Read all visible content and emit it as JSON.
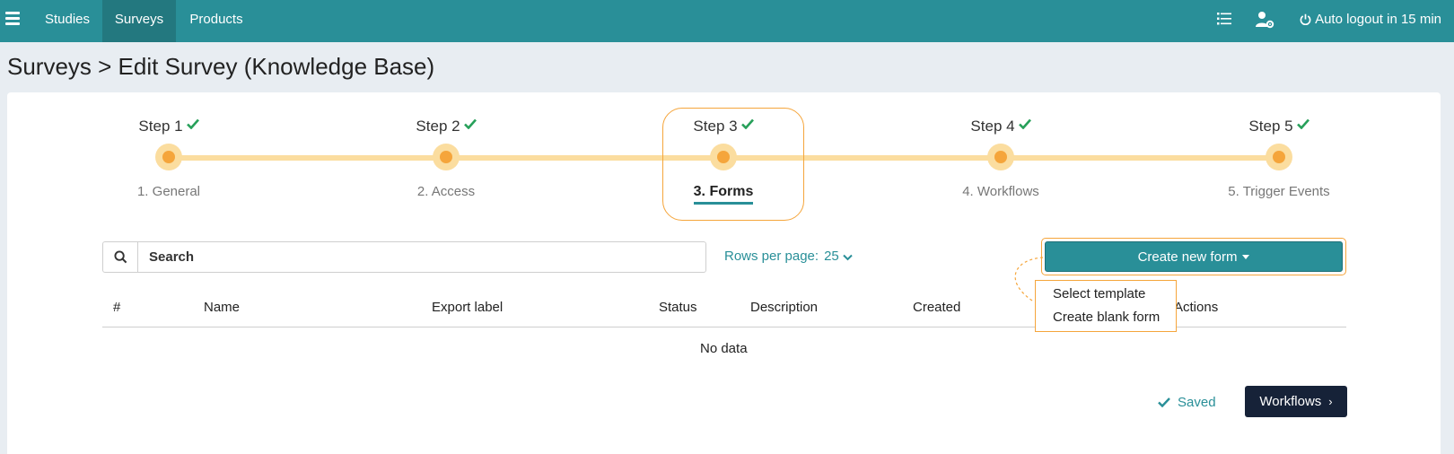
{
  "nav": {
    "items": [
      {
        "label": "Studies",
        "active": false
      },
      {
        "label": "Surveys",
        "active": true
      },
      {
        "label": "Products",
        "active": false
      }
    ],
    "icons": [
      "hamburger-icon",
      "list-icon",
      "user-settings-icon",
      "power-icon"
    ],
    "logout_text": "Auto logout in 15 min"
  },
  "page": {
    "title": "Surveys > Edit Survey (Knowledge Base)"
  },
  "stepper": {
    "steps": [
      {
        "title": "Step 1",
        "label": "1. General",
        "completed": true,
        "active": false
      },
      {
        "title": "Step 2",
        "label": "2. Access",
        "completed": true,
        "active": false
      },
      {
        "title": "Step 3",
        "label": "3. Forms",
        "completed": true,
        "active": true
      },
      {
        "title": "Step 4",
        "label": "4. Workflows",
        "completed": true,
        "active": false
      },
      {
        "title": "Step 5",
        "label": "5. Trigger Events",
        "completed": true,
        "active": false
      }
    ]
  },
  "search": {
    "placeholder": "Search",
    "value": ""
  },
  "pagination": {
    "rows_label": "Rows per page:",
    "rows_value": "25"
  },
  "create": {
    "label": "Create new form",
    "menu": [
      "Select template",
      "Create blank form"
    ]
  },
  "table": {
    "columns": [
      "#",
      "Name",
      "Export label",
      "Status",
      "Description",
      "Created",
      "Actions"
    ],
    "empty_text": "No data"
  },
  "footer": {
    "saved_text": "Saved",
    "next_label": "Workflows"
  },
  "colors": {
    "primary": "#298f98",
    "accent": "#f5a53b",
    "step_track": "#fbdd9f",
    "success": "#27a05a",
    "dark_button": "#162238"
  }
}
